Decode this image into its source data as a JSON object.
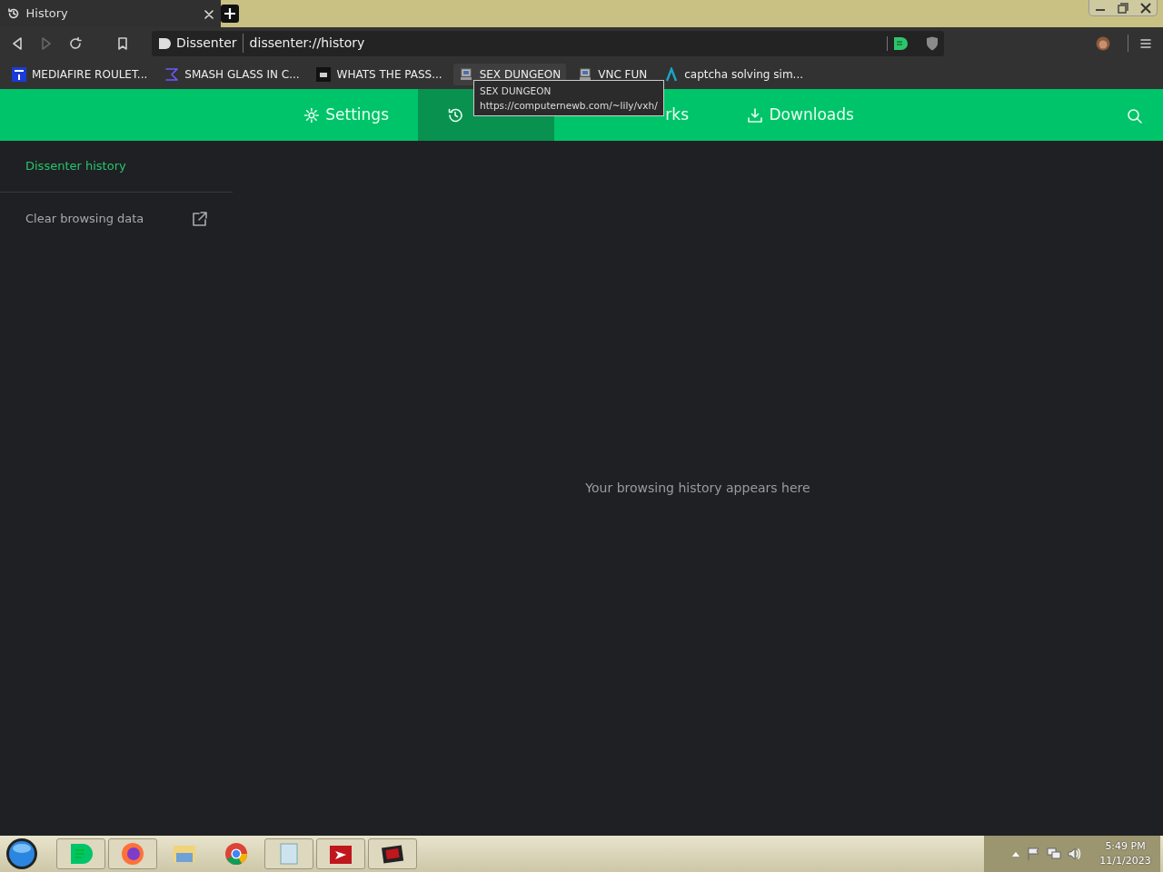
{
  "browser_tabs": [
    {
      "title": "History",
      "selected": true
    }
  ],
  "address_bar": {
    "site": "Dissenter",
    "url": "dissenter://history"
  },
  "bookmarks": [
    {
      "label": "MEDIAFIRE ROULET...",
      "kind": "mf",
      "hovered": false
    },
    {
      "label": "SMASH GLASS IN C...",
      "kind": "sigma",
      "hovered": false
    },
    {
      "label": "WHATS THE PASS...",
      "kind": "dark",
      "hovered": false
    },
    {
      "label": "SEX DUNGEON",
      "kind": "pc",
      "hovered": true
    },
    {
      "label": "VNC FUN",
      "kind": "pc",
      "hovered": false
    },
    {
      "label": "captcha solving sim...",
      "kind": "lambda",
      "hovered": false
    }
  ],
  "tooltip": {
    "title": "SEX DUNGEON",
    "url": "https://computernewb.com/~lily/vxh/"
  },
  "nav_tabs": [
    {
      "label": "Settings",
      "kind": "gear",
      "selected": false
    },
    {
      "kind": "clock",
      "selected": true
    },
    {
      "label": "rks",
      "kind": "book",
      "selected": false
    },
    {
      "label": "Downloads",
      "kind": "download",
      "selected": false
    }
  ],
  "sidebar": {
    "items": [
      {
        "label": "Dissenter history",
        "selected": true,
        "kind": "link"
      },
      {
        "label": "Clear browsing data",
        "selected": false,
        "kind": "external"
      }
    ]
  },
  "empty_message": "Your browsing history appears here",
  "taskbar": {
    "apps": [
      {
        "kind": "chat",
        "running": true
      },
      {
        "kind": "firefox",
        "running": true
      },
      {
        "kind": "folder",
        "running": false
      },
      {
        "kind": "chrome",
        "running": false
      },
      {
        "kind": "notepad",
        "running": true
      },
      {
        "kind": "red",
        "running": true
      },
      {
        "kind": "red2",
        "running": true
      }
    ],
    "time": "5:49 PM",
    "date": "11/1/2023"
  }
}
